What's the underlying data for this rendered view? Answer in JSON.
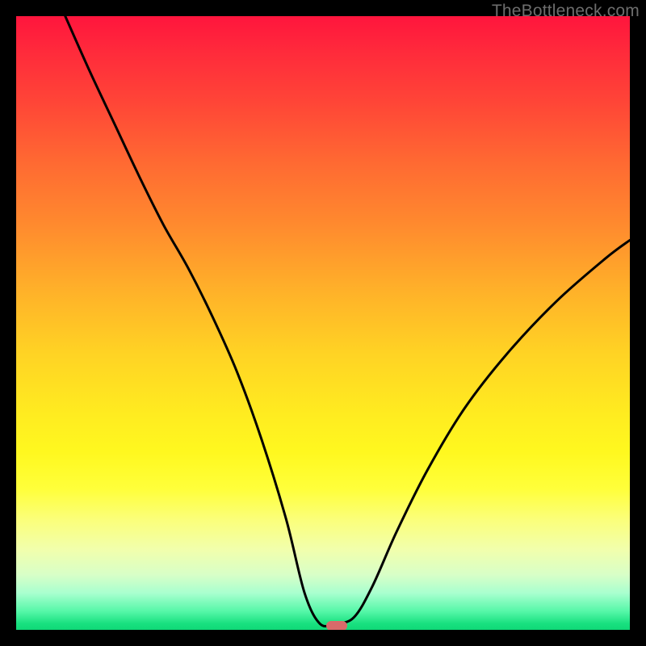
{
  "watermark": "TheBottleneck.com",
  "marker": {
    "x_pct": 52.3,
    "y_pct": 99.3,
    "color": "#d86a6a"
  },
  "chart_data": {
    "type": "line",
    "title": "",
    "xlabel": "",
    "ylabel": "",
    "xlim": [
      0,
      100
    ],
    "ylim": [
      0,
      100
    ],
    "grid": false,
    "legend": false,
    "background_gradient": {
      "direction": "vertical",
      "stops": [
        {
          "pos": 0,
          "color": "#ff153d"
        },
        {
          "pos": 14,
          "color": "#ff4537"
        },
        {
          "pos": 34,
          "color": "#ff8a2e"
        },
        {
          "pos": 55,
          "color": "#ffd324"
        },
        {
          "pos": 77,
          "color": "#ffff3a"
        },
        {
          "pos": 91,
          "color": "#d8ffc7"
        },
        {
          "pos": 100,
          "color": "#10d877"
        }
      ]
    },
    "series": [
      {
        "name": "bottleneck-curve",
        "color": "#000000",
        "x": [
          8.0,
          12.0,
          16.0,
          20.0,
          24.0,
          28.0,
          32.0,
          36.0,
          40.0,
          44.0,
          47.0,
          49.5,
          52.0,
          55.0,
          58.0,
          62.0,
          67.0,
          73.0,
          80.0,
          88.0,
          96.0,
          100.0
        ],
        "y": [
          100.0,
          91.0,
          82.5,
          74.0,
          66.0,
          59.0,
          51.0,
          42.0,
          31.0,
          18.0,
          6.0,
          1.0,
          1.0,
          2.0,
          7.0,
          16.0,
          26.0,
          36.0,
          45.0,
          53.5,
          60.5,
          63.5
        ]
      }
    ],
    "marker_point": {
      "x": 52.3,
      "y": 0.7
    }
  }
}
